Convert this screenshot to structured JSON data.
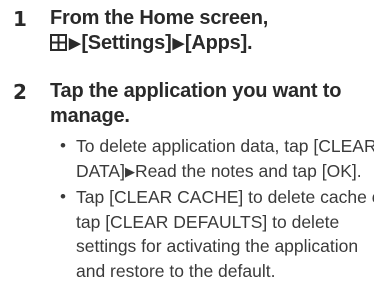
{
  "steps": [
    {
      "number": "1",
      "title_line1": "From the Home screen,",
      "title_line2_icon": "apps-grid-icon",
      "arrow": "▶",
      "path": [
        "[Settings]",
        "[Apps]."
      ]
    },
    {
      "number": "2",
      "title_line1": "Tap the application you want to",
      "title_line2": "manage.",
      "bullet_symbol": "•",
      "bullets": [
        {
          "line1": "To delete application data, tap [CLEAR",
          "line2_a": "DATA]",
          "line2_arrow": "▶",
          "line2_b": "Read the notes and tap [OK]."
        },
        {
          "line1": "Tap [CLEAR CACHE] to delete cache or",
          "line2": "tap [CLEAR DEFAULTS] to delete",
          "line3": "settings for activating the application",
          "line4": "and restore to the default."
        }
      ]
    }
  ]
}
